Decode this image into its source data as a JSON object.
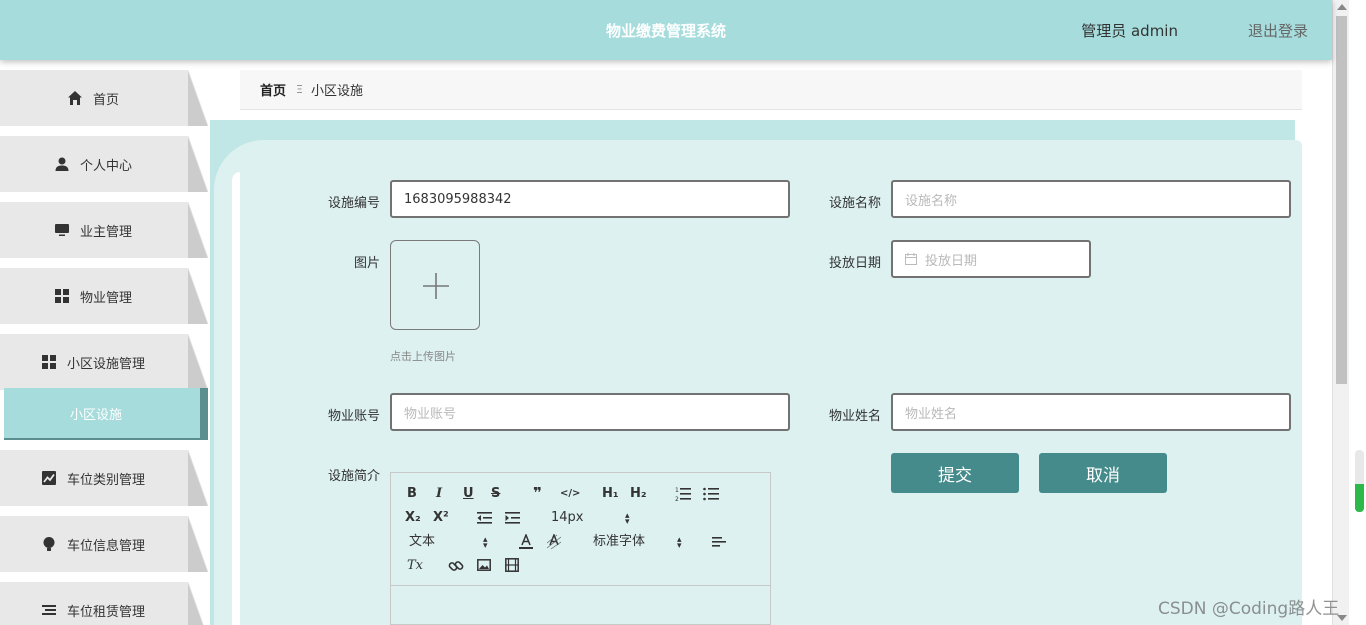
{
  "header": {
    "title": "物业缴费管理系统",
    "user": "管理员 admin",
    "logout": "退出登录"
  },
  "sidebar": {
    "items": [
      {
        "label": "首页",
        "icon": "home-icon"
      },
      {
        "label": "个人中心",
        "icon": "user-icon"
      },
      {
        "label": "业主管理",
        "icon": "monitor-icon"
      },
      {
        "label": "物业管理",
        "icon": "grid-icon"
      },
      {
        "label": "小区设施管理",
        "icon": "grid-icon"
      },
      {
        "label": "车位类别管理",
        "icon": "chart-icon"
      },
      {
        "label": "车位信息管理",
        "icon": "bulb-icon"
      },
      {
        "label": "车位租赁管理",
        "icon": "list-icon"
      }
    ],
    "sub_active": "小区设施"
  },
  "breadcrumb": {
    "home": "首页",
    "separator": "Ξ",
    "current": "小区设施"
  },
  "form": {
    "code_label": "设施编号",
    "code_value": "1683095988342",
    "name_label": "设施名称",
    "name_placeholder": "设施名称",
    "image_label": "图片",
    "upload_tip": "点击上传图片",
    "date_label": "投放日期",
    "date_placeholder": "投放日期",
    "account_label": "物业账号",
    "account_placeholder": "物业账号",
    "staff_label": "物业姓名",
    "staff_placeholder": "物业姓名",
    "intro_label": "设施简介",
    "submit": "提交",
    "cancel": "取消"
  },
  "editor": {
    "bold": "B",
    "italic": "I",
    "underline": "U",
    "strike": "S",
    "quote": "❞",
    "code": "</>",
    "h1": "H₁",
    "h2": "H₂",
    "sub": "X₂",
    "sup": "X²",
    "size": "14px",
    "header_select": "文本",
    "font_select": "标准字体",
    "clean": "Tx"
  },
  "watermark": "CSDN @Coding路人王",
  "colors": {
    "accent": "#a6dcdc",
    "button": "#458b8b",
    "card": "#ddf1f1"
  }
}
